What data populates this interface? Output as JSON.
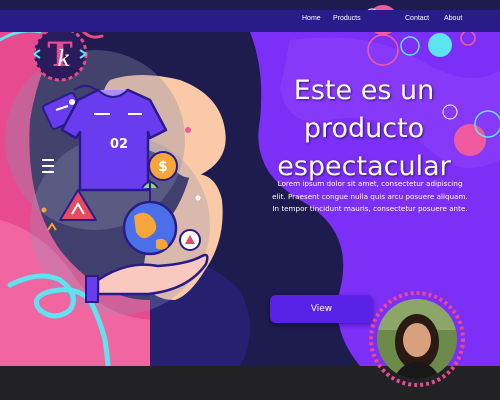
{
  "nav": {
    "links": [
      "Home",
      "Products",
      "Contact",
      "About"
    ]
  },
  "hero": {
    "title_line1": "Este es un producto",
    "title_line2": "espectacular",
    "body": "Lorem ipsum dolor sit amet, consectetur adipiscing elit. Praesent congue nulla quis arcu posuere aliquam. In tempor tincidunt mauris, consectetur posuere ante.",
    "view_button": "View"
  },
  "illustration": {
    "jersey_number": "02"
  },
  "colors": {
    "nav_bar": "#2a1b8a",
    "button": "#5a22e8",
    "purple_blob": "#7b2ff7",
    "pink": "#f05aa0",
    "cyan": "#5ee4f0",
    "peach": "#f9c9a8"
  }
}
